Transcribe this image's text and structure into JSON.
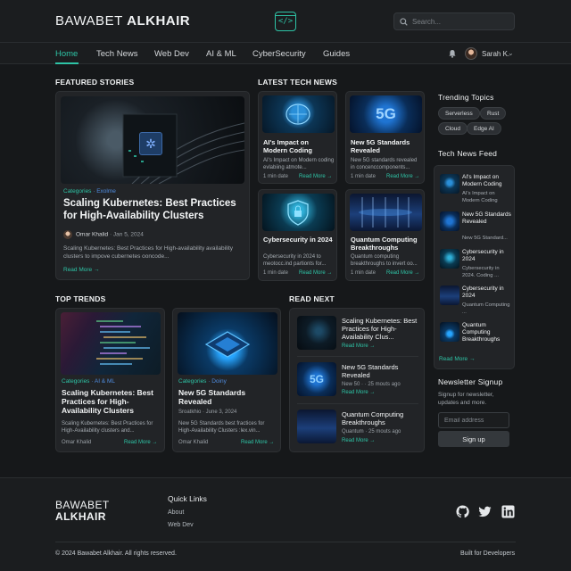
{
  "brand": {
    "part1": "BAWABET",
    "part2": "ALKHAIR"
  },
  "header": {
    "search_placeholder": "Search...",
    "user": "Sarah K."
  },
  "nav": {
    "items": [
      "Home",
      "Tech News",
      "Web Dev",
      "AI & ML",
      "CyberSecurity",
      "Guides"
    ]
  },
  "featured": {
    "heading": "FEATURED STORIES",
    "category": "Categories",
    "subcategory": "· Exolme",
    "title": "Scaling Kubernetes: Best Practices for High-Availability Clusters",
    "author": "Omar Khalid",
    "date": "· Jan 5, 2024",
    "desc": "Scaling Kubernetes: Best Practices for High-availability availability clusters to impove cubernetes ooncode...",
    "more": "Read More →"
  },
  "latest": {
    "heading": "LATEST TECH NEWS",
    "items": [
      {
        "title": "AI's Impact on Modern Coding",
        "desc": "AI's Impact on Modern coding evlabiing atmote...",
        "time": "1 min date",
        "more": "Read More →"
      },
      {
        "title": "New 5G Standards Revealed",
        "desc": "New 5G standards revealed in concenccomponents...",
        "time": "1 min date",
        "more": "Read More →"
      },
      {
        "title": "Cybersecurity in 2024",
        "desc": "Cybersecurity in 2024 to meotocc.ind partionts for...",
        "time": "1 min date",
        "more": "Read More →"
      },
      {
        "title": "Quantum Computing Breakthroughs",
        "desc": "Quantum computing breakthroughs to invert oo...",
        "time": "1 min date",
        "more": "Read More →"
      }
    ]
  },
  "trending": {
    "heading": "Trending Topics",
    "tags": [
      "Serverless",
      "Rust",
      "Cloud",
      "Edge AI"
    ]
  },
  "feed": {
    "heading": "Tech News Feed",
    "items": [
      {
        "title": "AI's Impact on Modern Coding",
        "sub": "AI's Impact on Modern Coding"
      },
      {
        "title": "New 5G Standards Revealed",
        "sub": "New 5G Standard..."
      },
      {
        "title": "Cybersecurity in 2024",
        "sub": "Cybersecurity in 2024. Coding ..."
      },
      {
        "title": "Cybersecurity in 2024",
        "sub": "Quantum Computing ..."
      },
      {
        "title": "Quantum Computing Breakthroughs",
        "sub": ""
      }
    ],
    "more": "Read More →"
  },
  "newsletter": {
    "heading": "Newsletter Signup",
    "desc": "Signup for newsletter, updates and more.",
    "placeholder": "Email address",
    "button": "Sign up"
  },
  "trends": {
    "heading": "TOP TRENDS",
    "items": [
      {
        "category": "Categories",
        "subcategory": "· AI & ML",
        "title": "Scaling Kubernetes: Best Practices for High-Availability Clusters",
        "desc": "Scaling Kubernetes: Best Practices for High-Availability clusters and...",
        "author": "Omar Khalid",
        "more": "Read More →"
      },
      {
        "category": "Categories",
        "subcategory": "· Doiny",
        "title": "New 5G Standards Revealed",
        "meta": "Sroatkhio · June 3, 2024",
        "desc": "New 5G Standards best fractices for High-Availability Clusters :lex.vin...",
        "author": "Omar Khalid",
        "more": "Read More →"
      }
    ]
  },
  "readnext": {
    "heading": "READ NEXT",
    "items": [
      {
        "title": "Scaling Kubernetes: Best Practices for High-Availability Clus...",
        "meta": "",
        "more": "Read More →"
      },
      {
        "title": "New 5G Standards Revealed",
        "meta": "New 50 · · 25 mouts ago",
        "more": "Read More →"
      },
      {
        "title": "Quantum Computing Breakthroughs",
        "meta": "Quantum · 25 mouts ago",
        "more": "Read More →"
      }
    ]
  },
  "footer": {
    "quick_links": "Quick Links",
    "links": [
      "About",
      "Web Dev"
    ],
    "copyright": "© 2024 Bawabet Alkhair. All rights reserved.",
    "built": "Built for Developers"
  },
  "glyphs": {
    "code": "</>",
    "fiveg": "5G",
    "kube": "✲",
    "lock": "🔒",
    "search": "⌕"
  },
  "colors": {
    "accent": "#2ec4a6",
    "link": "#4f8de0",
    "bg": "#16181a",
    "card": "#222427"
  }
}
